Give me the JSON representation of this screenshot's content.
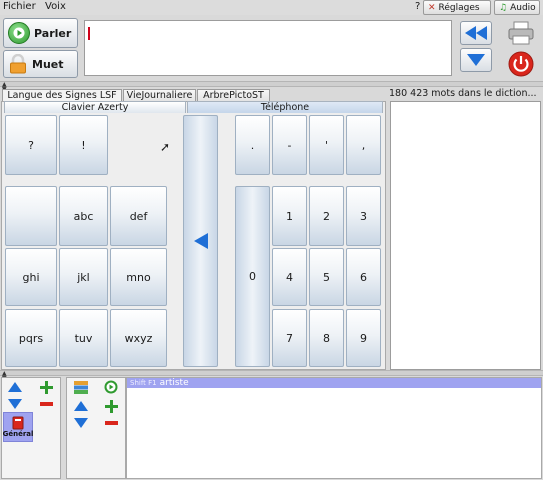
{
  "menu": {
    "file": "Fichier",
    "voice": "Voix",
    "help": "?"
  },
  "top_buttons": {
    "settings": "Réglages",
    "audio": "Audio"
  },
  "toolbar": {
    "speak": "Parler",
    "mute": "Muet"
  },
  "tabs": [
    "Langue des Signes LSF",
    "VieJournaliere",
    "ArbrePictoST"
  ],
  "subtabs": {
    "azerty": "Clavier Azerty",
    "phone": "Téléphone"
  },
  "dictionary_status": "180 423 mots dans le diction...",
  "keys_left": {
    "row1": [
      "?",
      "!"
    ],
    "row2": [
      "",
      "abc",
      "def"
    ],
    "row3": [
      "ghi",
      "jkl",
      "mno"
    ],
    "row4": [
      "pqrs",
      "tuv",
      "wxyz"
    ]
  },
  "keys_right": {
    "row1": [
      ".",
      "-",
      "'",
      ","
    ],
    "row2": [
      "1",
      "2",
      "3"
    ],
    "row3": [
      "4",
      "5",
      "6"
    ],
    "row4": [
      "7",
      "8",
      "9"
    ],
    "zero": "0"
  },
  "category": {
    "label": "Général"
  },
  "shortcut": {
    "key": "Shift F1",
    "text": "artiste"
  },
  "colors": {
    "accent_blue": "#1f6fd6",
    "green": "#2f9a2f",
    "red": "#d9261c",
    "selection": "#9fa3f0"
  }
}
